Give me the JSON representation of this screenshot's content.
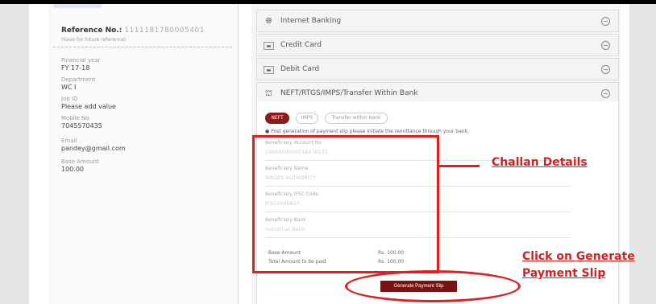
{
  "reference": {
    "label": "Reference No.:",
    "number": "1111181780005401",
    "subtext": "(Save for future reference)"
  },
  "details": [
    {
      "label": "Financial year",
      "value": "FY 17-18"
    },
    {
      "label": "Department",
      "value": "WC I"
    },
    {
      "label": "Job ID",
      "value": "Please add value"
    },
    {
      "label": "Mobile No",
      "value": "7045570435"
    },
    {
      "label": "Email",
      "value": "pandey@gmail.com"
    },
    {
      "label": "Base Amount",
      "value": "100.00"
    }
  ],
  "payment_methods": [
    {
      "label": "Internet Banking",
      "icon": "globe-icon",
      "toggle": "⊖"
    },
    {
      "label": "Credit Card",
      "icon": "credit-card-icon",
      "toggle": "⊖"
    },
    {
      "label": "Debit Card",
      "icon": "debit-card-icon",
      "toggle": "⊖"
    },
    {
      "label": "NEFT/RTGS/IMPS/Transfer Within Bank",
      "icon": "bank-icon",
      "toggle": "⊖"
    }
  ],
  "neft": {
    "tabs": [
      "NEFT",
      "IMPS",
      "Transfer within bank"
    ],
    "active_tab": "NEFT",
    "note_bullet": "●",
    "note": "Post generation of payment slip please initiate the remittance through your bank.",
    "fields": [
      {
        "label": "Beneficiary Account No",
        "value": "2908000000018476531"
      },
      {
        "label": "Beneficiary Name",
        "value": "WAGES AUTHORITY"
      },
      {
        "label": "Beneficiary IFSC Code",
        "value": "IFSC0000837"
      },
      {
        "label": "Beneficiary Bank",
        "value": "Industrial Bank"
      }
    ],
    "base_amount_label": "Base Amount",
    "base_amount_value": "Rs. 100.00",
    "total_label": "Total Amount to be paid",
    "total_value": "Rs. 100.00",
    "generate_button": "Generate Payment Slip"
  },
  "annotations": {
    "challan": "Challan Details",
    "click_line1": "Click on Generate",
    "click_line2": "Payment Slip"
  },
  "colors": {
    "accent": "#8b1a1a",
    "annotation": "#e02020"
  }
}
